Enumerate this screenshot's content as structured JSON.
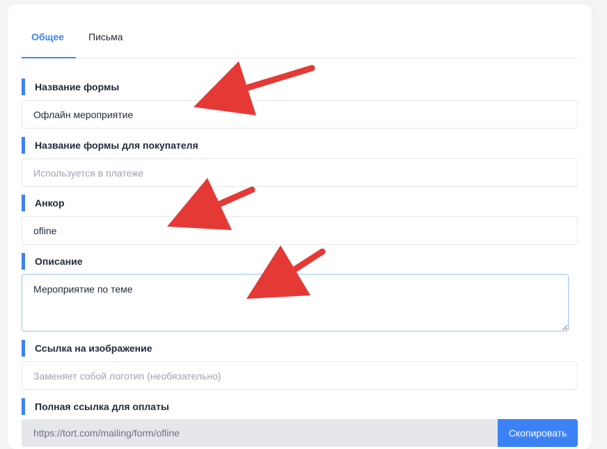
{
  "tabs": [
    {
      "label": "Общее",
      "active": true
    },
    {
      "label": "Письма",
      "active": false
    }
  ],
  "form": {
    "name": {
      "label": "Название формы",
      "value": "Офлайн мероприятие"
    },
    "buyer_name": {
      "label": "Название формы для покупателя",
      "placeholder": "Используется в платеже"
    },
    "anchor": {
      "label": "Анкор",
      "value": "ofline"
    },
    "description": {
      "label": "Описание",
      "value": "Мероприятие по теме"
    },
    "image_link": {
      "label": "Ссылка на изображение",
      "placeholder": "Заменяет собой логотип (необязательно)"
    },
    "payment_link": {
      "label": "Полная ссылка для оплаты",
      "value": "https://tort.com/mailing/form/ofline",
      "button_label": "Скопировать"
    }
  },
  "colors": {
    "accent": "#3b82f6",
    "annotation_arrow": "#e53935"
  }
}
